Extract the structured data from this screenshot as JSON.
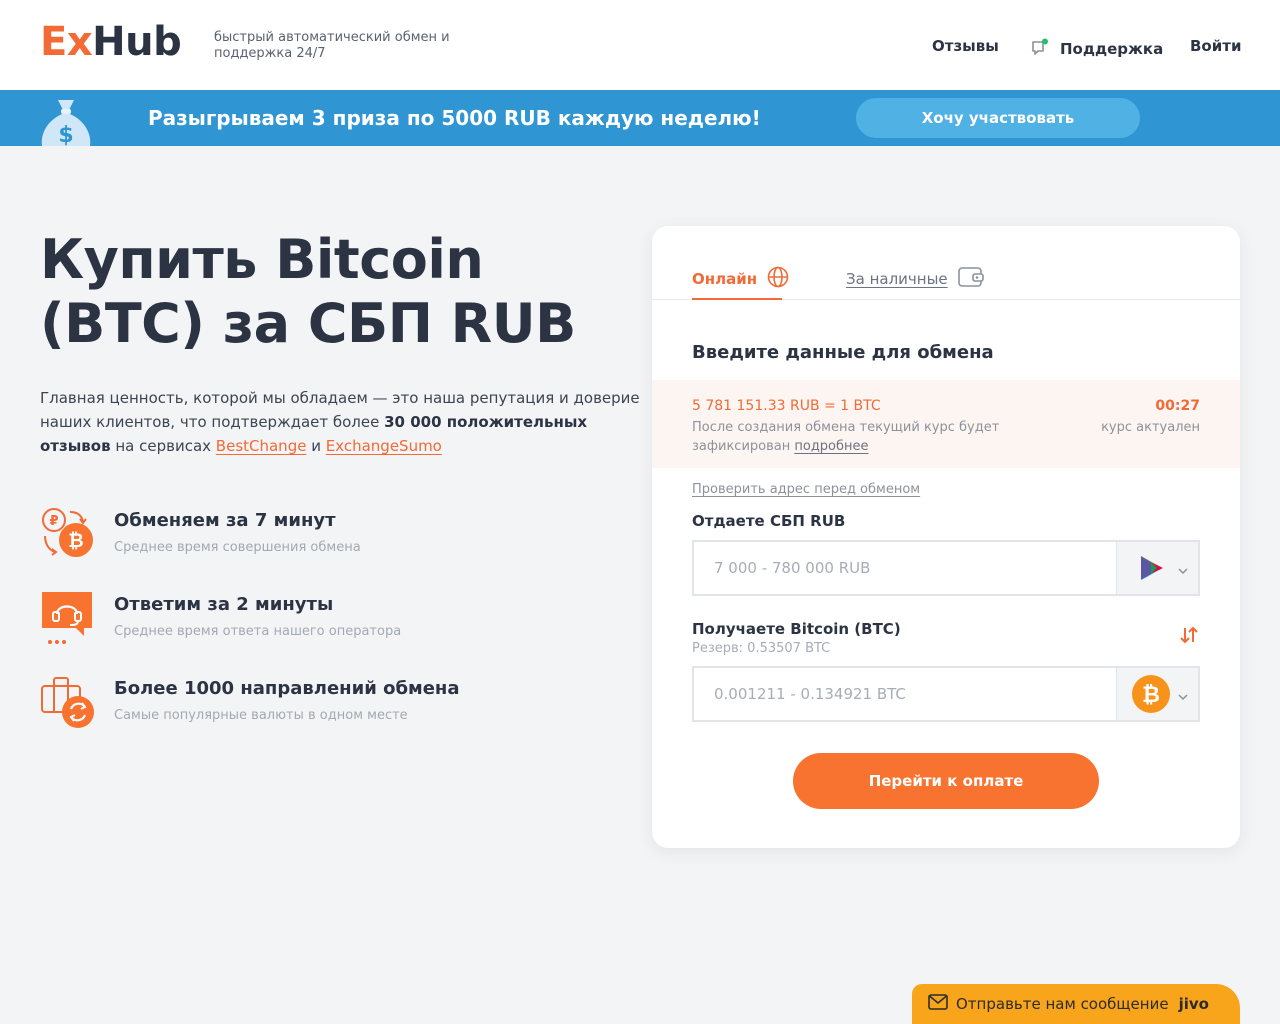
{
  "header": {
    "logo_ex": "Ex",
    "logo_hub": "Hub",
    "tagline": "быстрый автоматический обмен и поддержка 24/7",
    "nav": {
      "reviews": "Отзывы",
      "support": "Поддержка",
      "login": "Войти"
    }
  },
  "banner": {
    "text": "Разыгрываем 3 приза по 5000 RUB каждую неделю!",
    "button": "Хочу участвовать"
  },
  "hero": {
    "title_line1": "Купить Bitcoin",
    "title_line2": "(BTC) за СБП RUB",
    "lead_part1": "Главная ценность, которой мы обладаем — это наша репутация и доверие наших клиентов, что подтверждает более ",
    "lead_bold": "30 000 положительных отзывов",
    "lead_part2": " на сервисах ",
    "link_bestchange": "BestChange",
    "lead_and": " и ",
    "link_exchangesumo": "ExchangeSumo"
  },
  "features": [
    {
      "title": "Обменяем за 7 минут",
      "subtitle": "Среднее время совершения обмена",
      "icon": "exchange-rub-btc-icon"
    },
    {
      "title": "Ответим за 2 минуты",
      "subtitle": "Среднее время ответа нашего оператора",
      "icon": "support-headset-icon"
    },
    {
      "title": "Более 1000 направлений обмена",
      "subtitle": "Самые популярные валюты в одном месте",
      "icon": "directions-briefcase-icon"
    }
  ],
  "exchange": {
    "tabs": {
      "online": "Онлайн",
      "cash": "За наличные"
    },
    "title": "Введите данные для обмена",
    "rate": "5 781 151.33 RUB = 1 BTC",
    "rate_note": "После создания обмена текущий курс будет зафиксирован ",
    "rate_note_link": "подробнее",
    "timer": "00:27",
    "rate_status": "курс актуален",
    "check_address": "Проверить адрес перед обменом",
    "give_label": "Отдаете СБП RUB",
    "give_placeholder": "7 000 - 780 000 RUB",
    "get_label": "Получаете Bitcoin (BTC)",
    "reserve": "Резерв: 0.53507 BTC",
    "get_placeholder": "0.001211 - 0.134921 BTC",
    "pay_button": "Перейти к оплате"
  },
  "chat": {
    "text": "Отправьте нам сообщение",
    "brand": "jivo"
  },
  "colors": {
    "accent": "#f26a35",
    "banner": "#2f95d3",
    "text": "#2c3444",
    "chat": "#f8a51c",
    "bitcoin": "#f7931a"
  }
}
